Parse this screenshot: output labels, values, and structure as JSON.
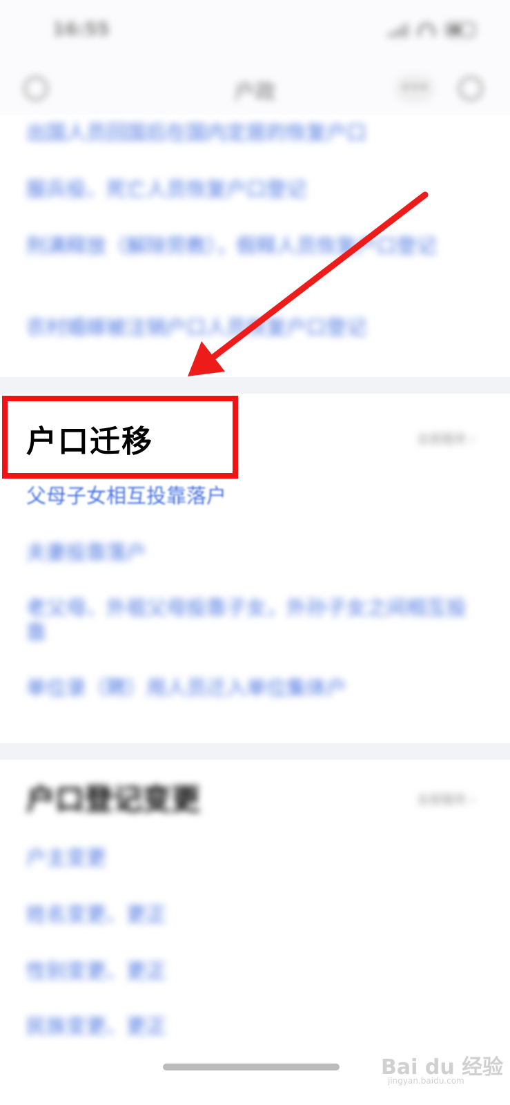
{
  "status_bar": {
    "time": "16:55"
  },
  "nav": {
    "title": "户政",
    "more": "•••"
  },
  "section_birth": {
    "items": [
      "出国人员回国后在国内定居的恢复户口",
      "服兵役、死亡人员恢复户口登记",
      "刑满释放（解除劳教），假释人员恢复户口登记",
      "农村婚嫁被注销户口人员恢复户口登记"
    ]
  },
  "section_migration": {
    "title": "户口迁移",
    "more": "全部服务 ›",
    "items": [
      "父母子女相互投靠落户",
      "夫妻投靠落户",
      "老父母、外祖父母投靠子女，外孙子女之间相互投靠",
      "单位录（聘）用人员迁入单位集体户"
    ]
  },
  "section_change": {
    "title": "户口登记变更",
    "more": "全部服务 ›",
    "items": [
      "户主变更",
      "姓名变更、更正",
      "性别变更、更正",
      "民族变更、更正"
    ]
  },
  "watermark": {
    "brand": "Bai du 经验",
    "url": "jingyan.baidu.com"
  },
  "colors": {
    "link": "#4a74e0",
    "highlight": "#f01316",
    "arrow": "#ee1b1b"
  }
}
